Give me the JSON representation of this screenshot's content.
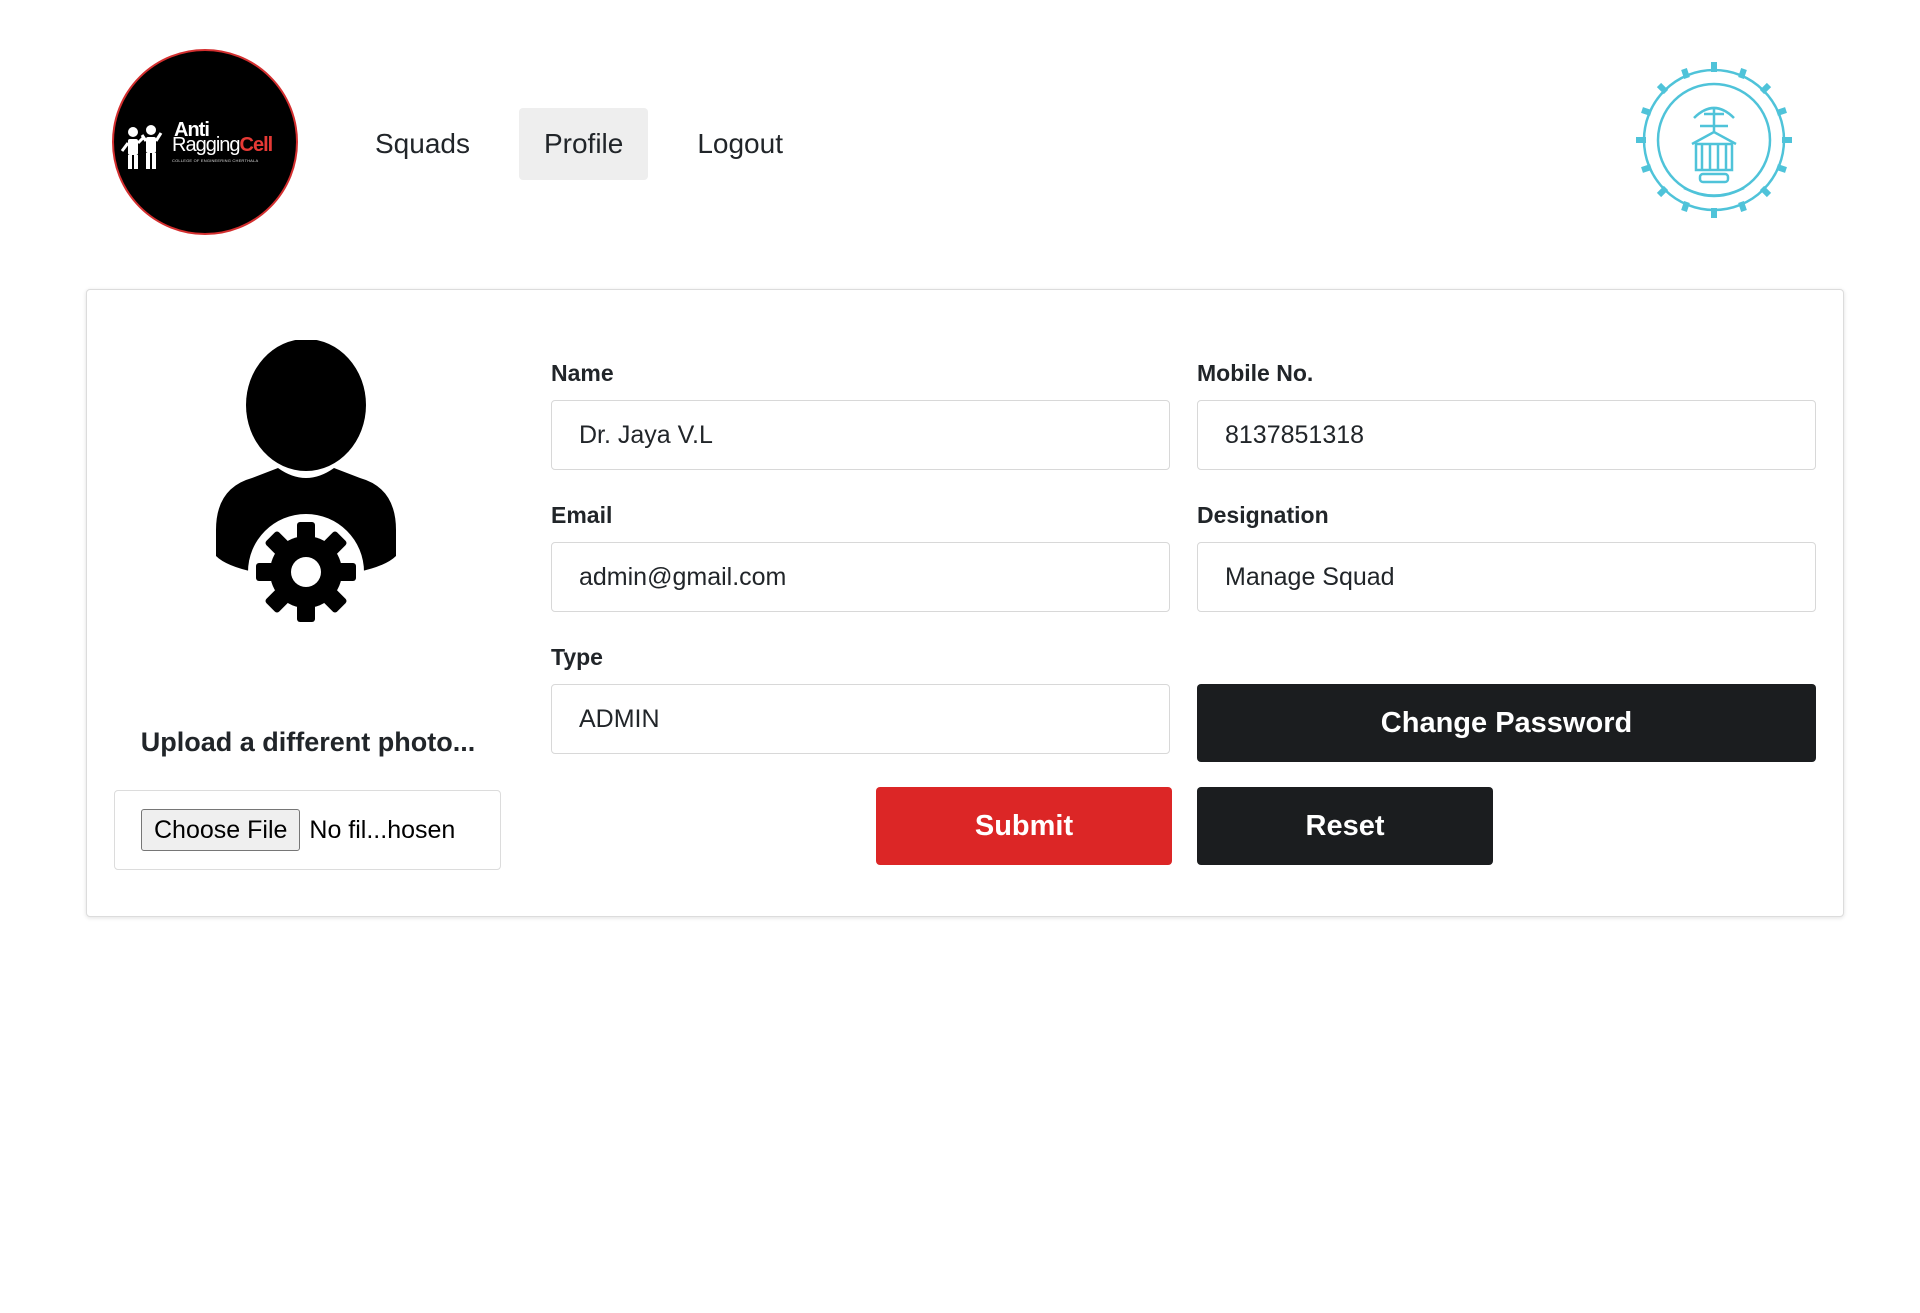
{
  "header": {
    "logo": {
      "line1": "Anti",
      "line2_a": "Ragging",
      "line2_b": "Cell",
      "subtitle": "COLLEGE OF ENGINEERING CHERTHALA"
    },
    "nav": [
      {
        "label": "Squads"
      },
      {
        "label": "Profile",
        "active": true
      },
      {
        "label": "Logout"
      }
    ],
    "seal_icon": "college-seal-icon"
  },
  "profile": {
    "avatar_icon": "user-gear-icon",
    "upload_label": "Upload a different photo...",
    "file_button": "Choose File",
    "file_status": "No fil...hosen",
    "fields": {
      "name": {
        "label": "Name",
        "value": "Dr. Jaya V.L"
      },
      "mobile": {
        "label": "Mobile No.",
        "value": "8137851318"
      },
      "email": {
        "label": "Email",
        "value": "admin@gmail.com"
      },
      "designation": {
        "label": "Designation",
        "value": "Manage Squad"
      },
      "type": {
        "label": "Type",
        "value": "ADMIN"
      }
    },
    "buttons": {
      "change_password": "Change Password",
      "submit": "Submit",
      "reset": "Reset"
    }
  },
  "colors": {
    "accent_red": "#dc2626",
    "dark_button": "#1b1d1f",
    "seal": "#4fc3d9"
  }
}
